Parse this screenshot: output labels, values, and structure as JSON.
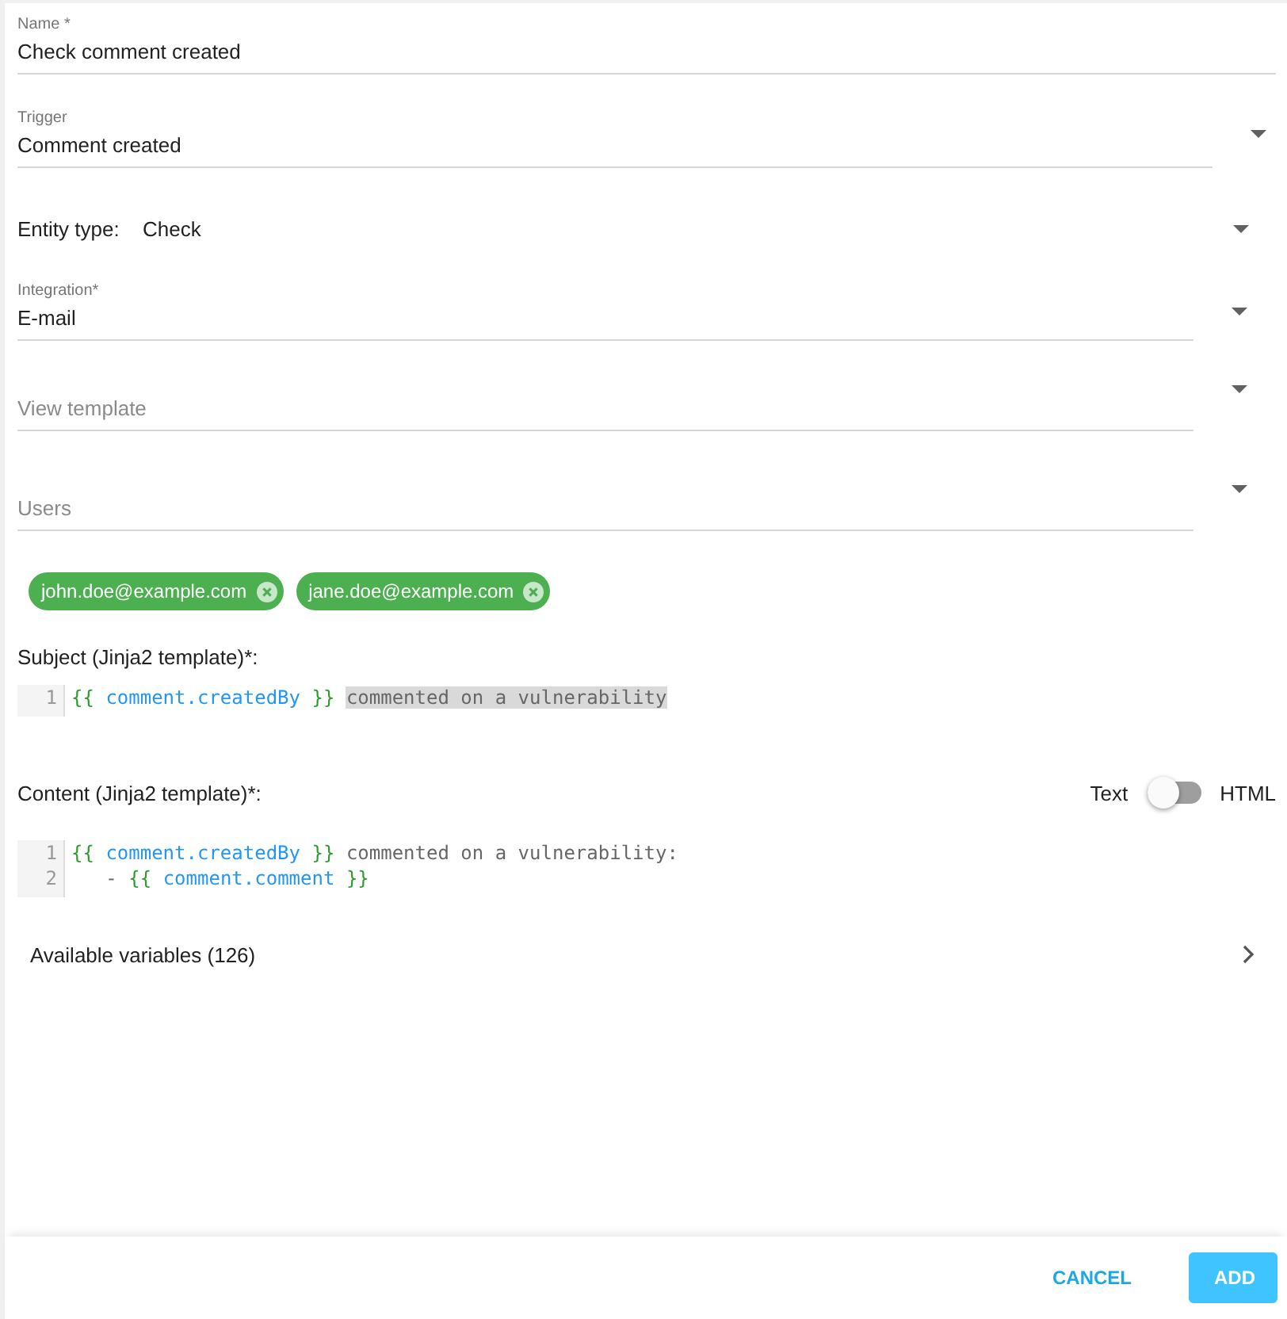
{
  "fields": [
    {
      "kind": "text",
      "label": "Name *",
      "value": "Check comment created"
    },
    {
      "kind": "select",
      "label": "Trigger",
      "value": "Comment created"
    },
    {
      "kind": "inline-select",
      "label": "Entity type:",
      "value": "Check"
    },
    {
      "kind": "select-short",
      "label": "Integration*",
      "value": "E-mail"
    },
    {
      "kind": "select-short",
      "placeholder": "View template"
    },
    {
      "kind": "select-short",
      "placeholder": "Users"
    }
  ],
  "chips": [
    {
      "label": "john.doe@example.com"
    },
    {
      "label": "jane.doe@example.com"
    }
  ],
  "subject": {
    "label": "Subject (Jinja2 template)*:",
    "lines": [
      {
        "number": "1",
        "tokens": [
          {
            "kind": "brace",
            "text": "{{"
          },
          {
            "kind": "var",
            "text": "comment.createdBy"
          },
          {
            "kind": "brace",
            "text": "}}"
          },
          {
            "kind": "text",
            "text": "commented on a vulnerability",
            "selected": true
          }
        ]
      }
    ]
  },
  "content": {
    "label": "Content (Jinja2 template)*:",
    "toggle": {
      "left_label": "Text",
      "right_label": "HTML",
      "on": false
    },
    "lines": [
      {
        "number": "1",
        "tokens": [
          {
            "kind": "brace",
            "text": "{{"
          },
          {
            "kind": "var",
            "text": "comment.createdBy"
          },
          {
            "kind": "brace",
            "text": "}}"
          },
          {
            "kind": "text",
            "text": "commented on a vulnerability:",
            "selected": false
          }
        ]
      },
      {
        "number": "2",
        "tokens": [
          {
            "kind": "text",
            "text": "   -",
            "selected": false
          },
          {
            "kind": "brace",
            "text": "{{"
          },
          {
            "kind": "var",
            "text": "comment.comment"
          },
          {
            "kind": "brace",
            "text": "}}"
          }
        ]
      }
    ]
  },
  "variables": {
    "label": "Available variables (126)",
    "expanded": false
  },
  "buttons": [
    {
      "kind": "flat",
      "label": "CANCEL"
    },
    {
      "kind": "raised",
      "label": "ADD"
    }
  ]
}
